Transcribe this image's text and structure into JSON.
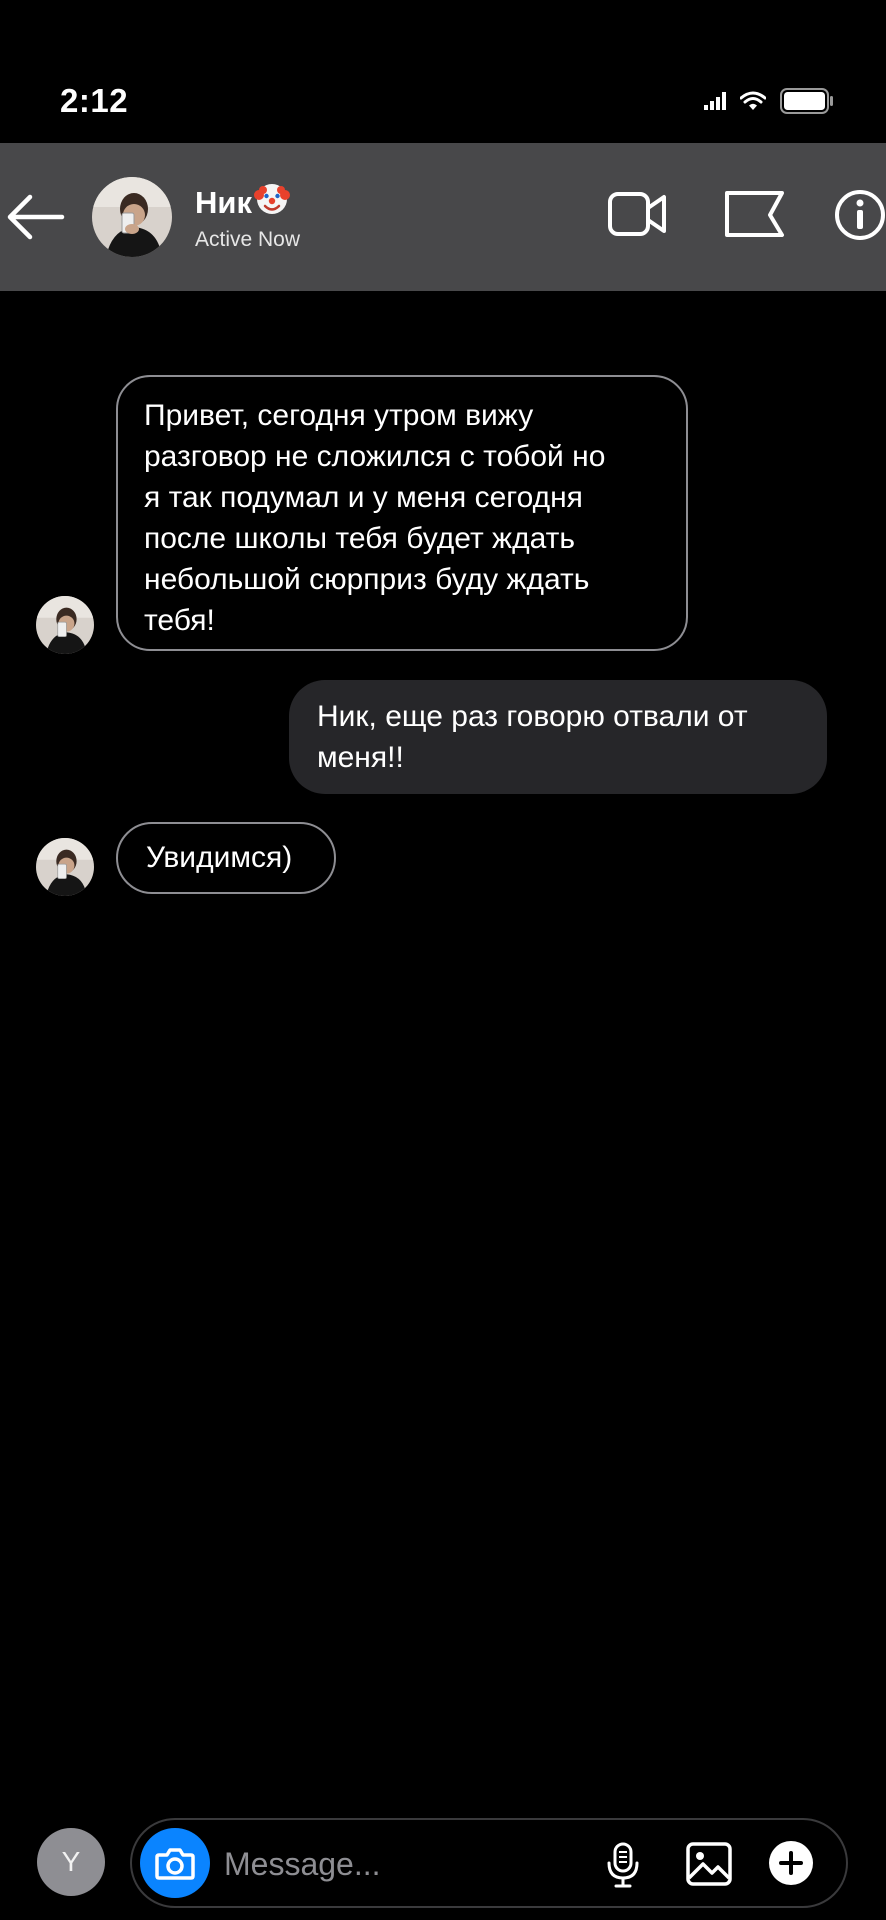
{
  "status_bar": {
    "time": "2:12"
  },
  "header": {
    "contact_name": "Ник",
    "name_emoji": "clown-face-emoji",
    "status": "Active Now"
  },
  "messages": [
    {
      "direction": "incoming",
      "text": "Привет, сегодня утром вижу\nразговор не сложился с тобой но\nя так подумал и у меня сегодня\nпосле школы тебя будет ждать\nнебольшой   сюрприз буду ждать\nтебя!"
    },
    {
      "direction": "outgoing",
      "text": "Ник, еще раз говорю отвали от\nменя!!"
    },
    {
      "direction": "incoming",
      "text": "Увидимся)"
    }
  ],
  "composer": {
    "avatar_letter": "Y",
    "placeholder": "Message..."
  },
  "colors": {
    "background": "#000000",
    "header_bg": "#48484a",
    "outgoing_bubble": "#262629",
    "incoming_border": "#8e8e93",
    "camera_button": "#0a84ff"
  }
}
